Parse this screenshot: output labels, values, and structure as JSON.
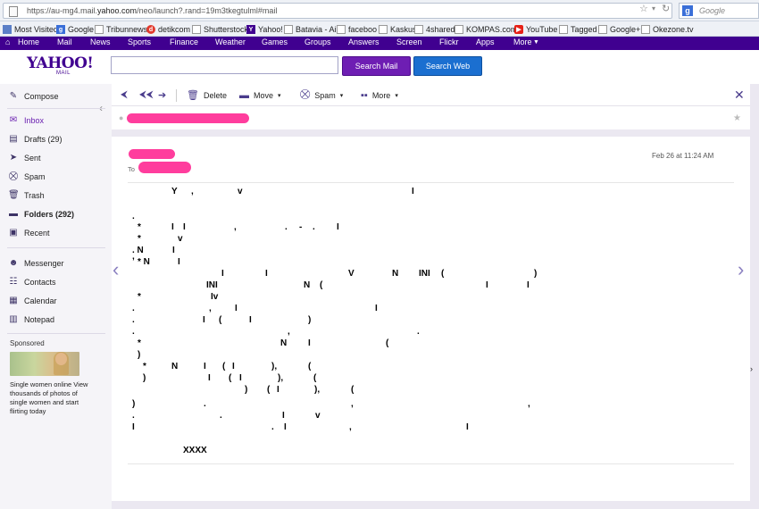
{
  "browser": {
    "url_prefix": "https://au-mg4.mail.",
    "url_domain": "yahoo.com",
    "url_suffix": "/neo/launch?.rand=19m3tkegtulml#mail",
    "search_engine_label": "Google",
    "search_placeholder": "Google",
    "bookmarks": [
      {
        "label": "Most Visited",
        "icon": "bookmarks-icon"
      },
      {
        "label": "Google",
        "icon": "google-icon"
      },
      {
        "label": "Tribunnews",
        "icon": "page-icon"
      },
      {
        "label": "detikcom",
        "icon": "detik-icon"
      },
      {
        "label": "Shutterstock",
        "icon": "page-icon"
      },
      {
        "label": "Yahoo!",
        "icon": "yahoo-icon"
      },
      {
        "label": "Batavia - Air",
        "icon": "page-icon"
      },
      {
        "label": "faceboo",
        "icon": "page-icon"
      },
      {
        "label": "Kaskus",
        "icon": "page-icon"
      },
      {
        "label": "4shared",
        "icon": "page-icon"
      },
      {
        "label": "KOMPAS.com",
        "icon": "kompas-icon"
      },
      {
        "label": "YouTube",
        "icon": "youtube-icon"
      },
      {
        "label": "Tagged",
        "icon": "page-icon"
      },
      {
        "label": "Google+",
        "icon": "page-icon"
      },
      {
        "label": "Okezone.tv",
        "icon": "page-icon"
      }
    ]
  },
  "yahoo_nav": [
    "Home",
    "Mail",
    "News",
    "Sports",
    "Finance",
    "Weather",
    "Games",
    "Groups",
    "Answers",
    "Screen",
    "Flickr",
    "Apps",
    "More"
  ],
  "header": {
    "logo": "YAHOO!",
    "logo_sub": "MAIL",
    "search_value": "",
    "search_mail": "Search Mail",
    "search_web": "Search Web"
  },
  "sidebar": {
    "compose": "Compose",
    "folders": [
      {
        "label": "Inbox",
        "icon": "envelope-icon"
      },
      {
        "label": "Drafts (29)",
        "icon": "drafts-icon"
      },
      {
        "label": "Sent",
        "icon": "sent-icon"
      },
      {
        "label": "Spam",
        "icon": "spam-icon"
      },
      {
        "label": "Trash",
        "icon": "trash-icon"
      },
      {
        "label": "Folders (292)",
        "icon": "folder-icon"
      },
      {
        "label": "Recent",
        "icon": "recent-icon"
      }
    ],
    "apps": [
      {
        "label": "Messenger",
        "icon": "messenger-icon"
      },
      {
        "label": "Contacts",
        "icon": "contacts-icon"
      },
      {
        "label": "Calendar",
        "icon": "calendar-icon"
      },
      {
        "label": "Notepad",
        "icon": "notepad-icon"
      }
    ],
    "sponsored_label": "Sponsored",
    "ad_text": "Single women online View thousands of photos of single women and start flirting today"
  },
  "toolbar": {
    "delete": "Delete",
    "move": "Move",
    "spam": "Spam",
    "more": "More"
  },
  "message": {
    "date": "Feb 26 at 11:24 AM",
    "to_label": "To"
  },
  "body_fragments": [
    {
      "text": "Y"
    },
    {
      "text": ","
    },
    {
      "text": "v"
    },
    {
      "text": "I"
    },
    {
      "text": "."
    },
    {
      "text": "*"
    },
    {
      "text": "I"
    },
    {
      "text": "I"
    },
    {
      "text": ","
    },
    {
      "text": "."
    },
    {
      "text": "-"
    },
    {
      "text": "."
    },
    {
      "text": "I"
    },
    {
      "text": "*"
    },
    {
      "text": "v"
    },
    {
      "text": ". N"
    },
    {
      "text": "I"
    },
    {
      "text": "* N"
    },
    {
      "text": "I"
    },
    {
      "text": "I"
    },
    {
      "text": "I"
    },
    {
      "text": "V"
    },
    {
      "text": "N"
    },
    {
      "text": "INI"
    },
    {
      "text": "("
    },
    {
      "text": ")"
    },
    {
      "text": "INI"
    },
    {
      "text": "N"
    },
    {
      "text": "("
    },
    {
      "text": "I"
    },
    {
      "text": "I"
    },
    {
      "text": "*"
    },
    {
      "text": "Iv"
    },
    {
      "text": "."
    },
    {
      "text": ","
    },
    {
      "text": "I"
    },
    {
      "text": "I"
    },
    {
      "text": "."
    },
    {
      "text": "I"
    },
    {
      "text": "("
    },
    {
      "text": "I"
    },
    {
      "text": ")"
    },
    {
      "text": "."
    },
    {
      "text": ","
    },
    {
      "text": "."
    },
    {
      "text": "*"
    },
    {
      "text": "N"
    },
    {
      "text": "I"
    },
    {
      "text": "("
    },
    {
      "text": ")"
    },
    {
      "text": "*"
    },
    {
      "text": "N"
    },
    {
      "text": "I"
    },
    {
      "text": "("
    },
    {
      "text": "I"
    },
    {
      "text": "),"
    },
    {
      "text": "("
    },
    {
      "text": ")"
    },
    {
      "text": "I"
    },
    {
      "text": "("
    },
    {
      "text": "I"
    },
    {
      "text": "),"
    },
    {
      "text": "("
    },
    {
      "text": ")"
    },
    {
      "text": "("
    },
    {
      "text": "I"
    },
    {
      "text": "),"
    },
    {
      "text": "("
    },
    {
      "text": ")"
    },
    {
      "text": "."
    },
    {
      "text": ","
    },
    {
      "text": ","
    },
    {
      "text": "."
    },
    {
      "text": "."
    },
    {
      "text": "I"
    },
    {
      "text": "v"
    },
    {
      "text": "I"
    },
    {
      "text": "."
    },
    {
      "text": "I"
    },
    {
      "text": ","
    },
    {
      "text": "I"
    },
    {
      "text": "XXXX"
    },
    {
      "text": ","
    }
  ],
  "colors": {
    "yahoo_purple": "#400090",
    "accent_purple": "#6a1fb0",
    "search_web_blue": "#1b6fd0",
    "redaction_pink": "#ff3d9d"
  }
}
